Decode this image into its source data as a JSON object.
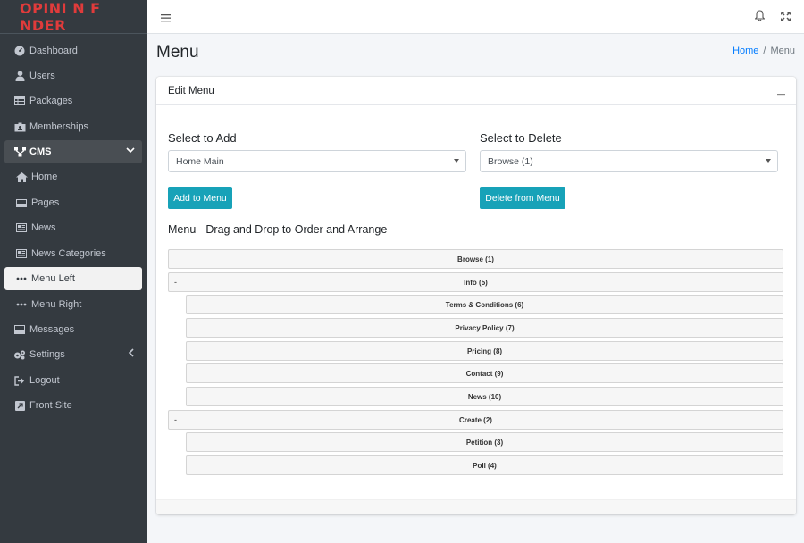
{
  "brand": {
    "logo_text": "OPINI N F NDER",
    "accent": "#e03b3b"
  },
  "sidebar": {
    "items": [
      {
        "label": "Dashboard",
        "icon": "dashboard-icon"
      },
      {
        "label": "Users",
        "icon": "user-icon"
      },
      {
        "label": "Packages",
        "icon": "table-icon"
      },
      {
        "label": "Memberships",
        "icon": "id-card-icon"
      },
      {
        "label": "CMS",
        "icon": "sitemap-icon"
      },
      {
        "label": "Home",
        "icon": "home-icon"
      },
      {
        "label": "Pages",
        "icon": "page-icon"
      },
      {
        "label": "News",
        "icon": "newspaper-icon"
      },
      {
        "label": "News Categories",
        "icon": "newspaper-icon"
      },
      {
        "label": "Menu Left",
        "icon": "ellipsis-icon"
      },
      {
        "label": "Menu Right",
        "icon": "ellipsis-icon"
      },
      {
        "label": "Messages",
        "icon": "inbox-icon"
      },
      {
        "label": "Settings",
        "icon": "cogs-icon"
      },
      {
        "label": "Logout",
        "icon": "sign-out-icon"
      },
      {
        "label": "Front Site",
        "icon": "external-site-icon"
      }
    ]
  },
  "page": {
    "title": "Menu"
  },
  "breadcrumb": {
    "home": "Home",
    "separator": "/",
    "current": "Menu"
  },
  "card": {
    "title": "Edit Menu"
  },
  "add": {
    "label": "Select to Add",
    "selected": "Home Main",
    "button": "Add to Menu"
  },
  "delete": {
    "label": "Select to Delete",
    "selected": "Browse (1)",
    "button": "Delete from Menu"
  },
  "menu_tree": {
    "title": "Menu -  Drag and Drop to Order and Arrange",
    "collapse_symbol": "-",
    "items": [
      {
        "label": "Browse (1)"
      },
      {
        "label": "Info (5)"
      },
      {
        "label": "Terms & Conditions (6)"
      },
      {
        "label": "Privacy Policy (7)"
      },
      {
        "label": "Pricing (8)"
      },
      {
        "label": "Contact (9)"
      },
      {
        "label": "News (10)"
      },
      {
        "label": "Create (2)"
      },
      {
        "label": "Petition (3)"
      },
      {
        "label": "Poll (4)"
      }
    ]
  },
  "colors": {
    "sidebar_bg": "#343a40",
    "primary_button": "#17a2b8",
    "link": "#007bff"
  }
}
